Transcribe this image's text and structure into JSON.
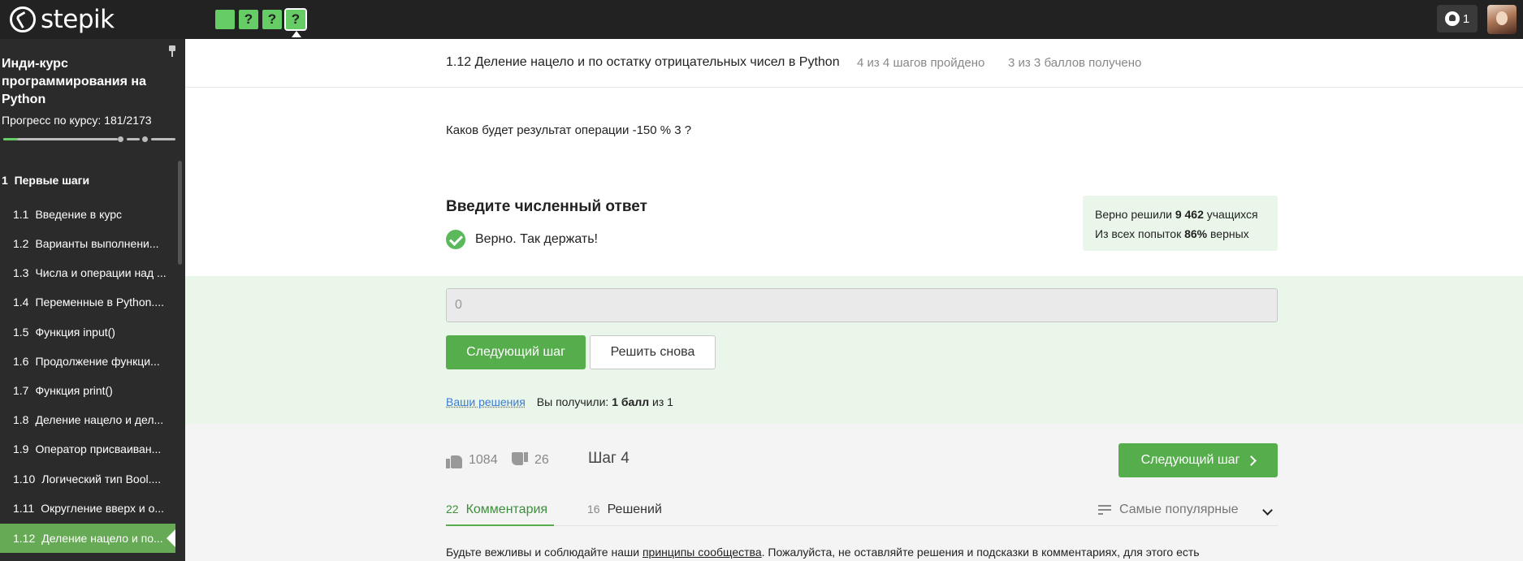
{
  "brand": {
    "name": "stepik"
  },
  "topbar": {
    "steps": [
      "",
      "?",
      "?",
      "?"
    ],
    "notifications_count": "1"
  },
  "sidebar": {
    "course_title": "Инди-курс программирования на Python",
    "progress_label": "Прогресс по курсу:",
    "progress_value": "181/2173",
    "progress_fraction": 0.083,
    "section": {
      "number": "1",
      "title": "Первые шаги"
    },
    "lessons": [
      {
        "number": "1.1",
        "title": "Введение в курс"
      },
      {
        "number": "1.2",
        "title": "Варианты выполнени..."
      },
      {
        "number": "1.3",
        "title": "Числа и операции над ..."
      },
      {
        "number": "1.4",
        "title": "Переменные в Python...."
      },
      {
        "number": "1.5",
        "title": "Функция input()"
      },
      {
        "number": "1.6",
        "title": "Продолжение функци..."
      },
      {
        "number": "1.7",
        "title": "Функция print()"
      },
      {
        "number": "1.8",
        "title": "Деление нацело и дел..."
      },
      {
        "number": "1.9",
        "title": "Оператор присваиван..."
      },
      {
        "number": "1.10",
        "title": "Логический тип Bool...."
      },
      {
        "number": "1.11",
        "title": "Округление вверх и о..."
      },
      {
        "number": "1.12",
        "title": "Деление нацело и по..."
      }
    ]
  },
  "lesson_header": {
    "title": "1.12 Деление нацело и по остатку отрицательных чисел в Python",
    "steps_done": "4 из 4 шагов пройдено",
    "points": "3 из 3 баллов  получено"
  },
  "step": {
    "question": "Каков будет результат операции -150 % 3 ?",
    "answer_title": "Введите численный ответ",
    "correct_message": "Верно. Так держать!",
    "stats": {
      "solved_prefix": "Верно решили",
      "solved_count": "9 462",
      "solved_suffix": "учащихся",
      "attempts_prefix": "Из всех попыток",
      "attempts_percent": "86%",
      "attempts_suffix": "верных"
    },
    "answer_value": "0",
    "next_button": "Следующий шаг",
    "retry_button": "Решить снова",
    "solutions_link": "Ваши решения",
    "score_prefix": "Вы получили:",
    "score_value": "1 балл",
    "score_suffix": "из 1"
  },
  "footer": {
    "likes": "1084",
    "dislikes": "26",
    "step_label": "Шаг 4",
    "next_button": "Следующий шаг",
    "tabs": [
      {
        "count": "22",
        "label": "Комментария"
      },
      {
        "count": "16",
        "label": "Решений"
      }
    ],
    "sort_label": "Самые популярные",
    "rules_prefix": "Будьте вежливы и соблюдайте наши",
    "rules_link": "принципы сообщества",
    "rules_suffix": ". Пожалуйста, не оставляйте решения и подсказки в комментариях, для этого есть"
  },
  "colors": {
    "topbar": "#222222",
    "sidebar": "#2b2b2b",
    "accent": "#56ad4c",
    "success_bg": "#e9f6e9"
  }
}
